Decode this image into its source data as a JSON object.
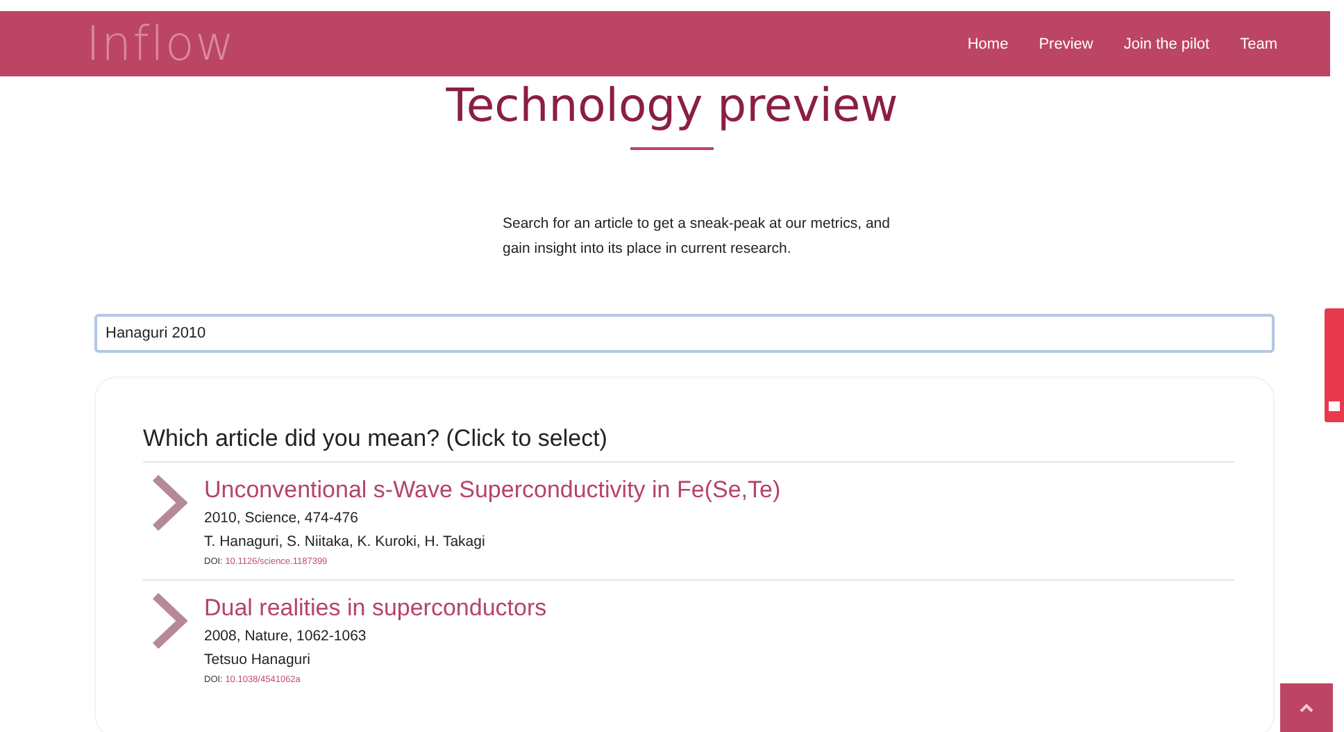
{
  "header": {
    "logo": "Inflow",
    "nav": [
      {
        "label": "Home"
      },
      {
        "label": "Preview"
      },
      {
        "label": "Join the pilot"
      },
      {
        "label": "Team"
      }
    ]
  },
  "title": "Technology preview",
  "intro": "Search for an article to get a sneak-peak at our metrics, and gain insight into its place in current research.",
  "search": {
    "value": "Hanaguri 2010"
  },
  "results": {
    "heading": "Which article did you mean? (Click to select)",
    "articles": [
      {
        "title": "Unconventional s-Wave Superconductivity in Fe(Se,Te)",
        "meta": "2010, Science, 474-476",
        "authors": "T. Hanaguri, S. Niitaka, K. Kuroki, H. Takagi",
        "doi_label": "DOI:",
        "doi": "10.1126/science.1187399"
      },
      {
        "title": "Dual realities in superconductors",
        "meta": "2008, Nature, 1062-1063",
        "authors": "Tetsuo Hanaguri",
        "doi_label": "DOI:",
        "doi": "10.1038/4541062a"
      }
    ]
  }
}
